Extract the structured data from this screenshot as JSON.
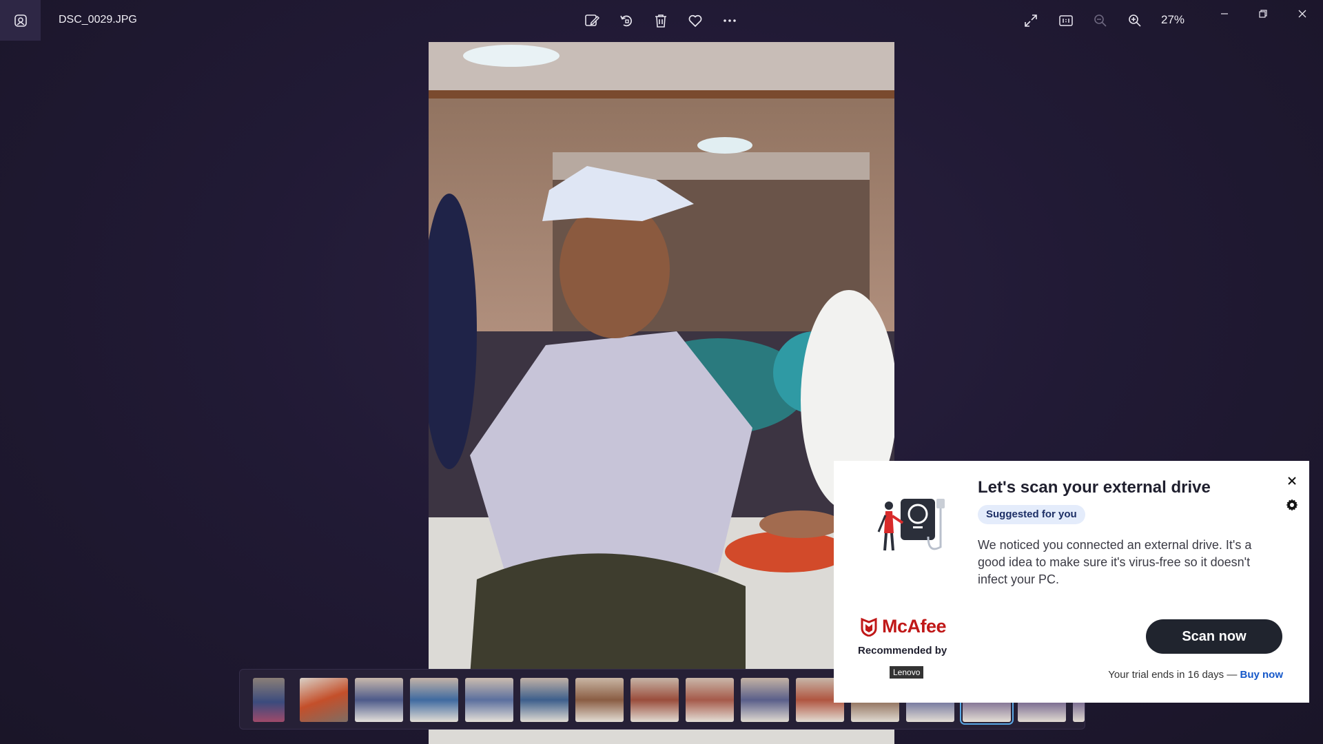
{
  "window": {
    "file_name": "DSC_0029.JPG",
    "zoom_level": "27%",
    "icons": {
      "app": "photos-app-icon",
      "edit": "edit-image-icon",
      "rotate": "rotate-icon",
      "delete": "delete-icon",
      "favorite": "heart-icon",
      "more": "more-icon",
      "fullscreen": "expand-icon",
      "actual_size": "actual-size-icon",
      "zoom_out": "zoom-out-icon",
      "zoom_in": "zoom-in-icon",
      "minimize": "minimize-icon",
      "restore": "restore-icon",
      "close": "close-icon"
    }
  },
  "filmstrip": {
    "thumbnail_count": 16,
    "selected_index": 13
  },
  "popup": {
    "title": "Let's scan your external drive",
    "badge": "Suggested for you",
    "description": "We noticed you connected an external drive. It's a good idea to make sure it's virus-free so it doesn't infect your PC.",
    "brand": "McAfee",
    "recommended_by": "Recommended by",
    "partner": "Lenovo",
    "scan_button": "Scan now",
    "trial_text": "Your trial ends in 16 days —",
    "buy_link": "Buy now",
    "brand_color": "#c01818"
  }
}
